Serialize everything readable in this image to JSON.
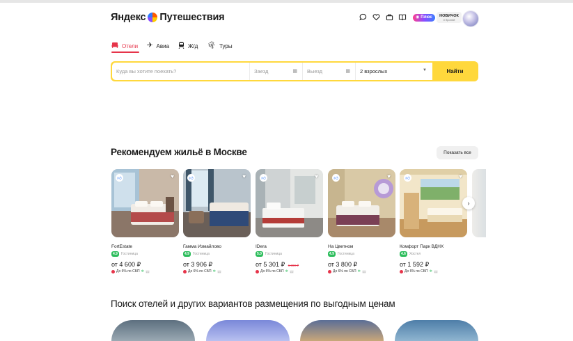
{
  "header": {
    "logo": "Яндекс",
    "logo_suffix": "Путешествия",
    "icons": [
      "chat-icon",
      "heart-icon",
      "bag-icon",
      "book-icon"
    ],
    "plus_label": "Плюс",
    "novice_title": "НОВИЧОК",
    "novice_sub": "0 броней"
  },
  "tabs": [
    {
      "label": "Отели",
      "icon": "bed-icon",
      "active": true
    },
    {
      "label": "Авиа",
      "icon": "plane-icon",
      "active": false
    },
    {
      "label": "Ж/д",
      "icon": "train-icon",
      "active": false
    },
    {
      "label": "Туры",
      "icon": "palm-icon",
      "active": false
    }
  ],
  "search": {
    "destination_placeholder": "Куда вы хотите поехать?",
    "checkin_placeholder": "Заезд",
    "checkout_placeholder": "Выезд",
    "guests_value": "2 взрослых",
    "button": "Найти"
  },
  "recommendations": {
    "title": "Рекомендуем жильё в Москве",
    "show_all": "Показать все",
    "cards": [
      {
        "name": "FortEstate",
        "rating": "4.9",
        "type": "Гостиница",
        "price": "от 4 600 ₽",
        "old_price": "",
        "cashback": "До 6% по СБП"
      },
      {
        "name": "Гамма Измайлово",
        "rating": "4.9",
        "type": "Гостиница",
        "price": "от 3 906 ₽",
        "old_price": "",
        "cashback": "До 6% по СБП"
      },
      {
        "name": "IDera",
        "rating": "5.0",
        "type": "Гостиница",
        "price": "от 5 301 ₽",
        "old_price": "6 890 ₽",
        "cashback": "До 6% по СБП"
      },
      {
        "name": "На Цветном",
        "rating": "4.9",
        "type": "Гостиница",
        "price": "от 3 800 ₽",
        "old_price": "",
        "cashback": "До 6% по СБП"
      },
      {
        "name": "Комфорт Парк ВДНХ",
        "rating": "4.6",
        "type": "Хостел",
        "price": "от 1 592 ₽",
        "old_price": "",
        "cashback": "До 6% по СБП"
      }
    ]
  },
  "search_section_title": "Поиск отелей и других вариантов размещения по выгодным ценам",
  "colors": {
    "accent": "#e6344a",
    "search_yellow": "#ffd83c",
    "rating_green": "#2dbd5c"
  }
}
